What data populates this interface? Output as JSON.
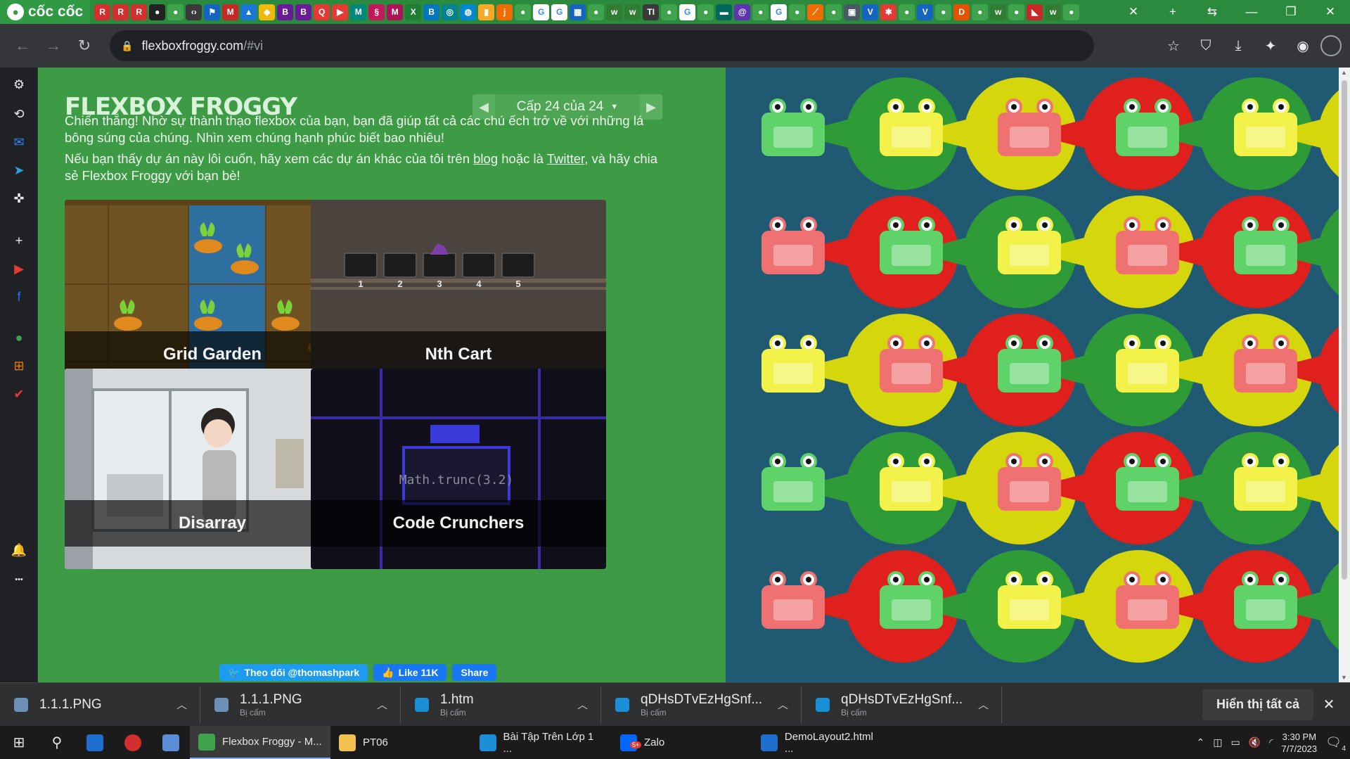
{
  "browser": {
    "brand_name": "cốc cốc",
    "tab_icons": [
      {
        "name": "tab-icon-r-1",
        "glyph": "R",
        "color": "#d32f2f"
      },
      {
        "name": "tab-icon-r-2",
        "glyph": "R",
        "color": "#d32f2f"
      },
      {
        "name": "tab-icon-r-3",
        "glyph": "R",
        "color": "#d32f2f"
      },
      {
        "name": "tab-icon-github",
        "glyph": "●",
        "color": "#222222"
      },
      {
        "name": "tab-icon-coccoc-1",
        "glyph": "●",
        "color": "#3fa34d"
      },
      {
        "name": "tab-icon-code",
        "glyph": "‹›",
        "color": "#3a3a3a"
      },
      {
        "name": "tab-icon-flag",
        "glyph": "⚑",
        "color": "#1565c0"
      },
      {
        "name": "tab-icon-gmail",
        "glyph": "M",
        "color": "#c62828"
      },
      {
        "name": "tab-icon-contacts",
        "glyph": "▲",
        "color": "#1976d2"
      },
      {
        "name": "tab-icon-binance",
        "glyph": "◆",
        "color": "#f0b90b"
      },
      {
        "name": "tab-icon-b-1",
        "glyph": "B",
        "color": "#6a1b9a"
      },
      {
        "name": "tab-icon-b-2",
        "glyph": "B",
        "color": "#6a1b9a"
      },
      {
        "name": "tab-icon-quiz",
        "glyph": "Q",
        "color": "#e53935"
      },
      {
        "name": "tab-icon-youtube",
        "glyph": "▶",
        "color": "#e53935"
      },
      {
        "name": "tab-icon-m",
        "glyph": "M",
        "color": "#00897b"
      },
      {
        "name": "tab-icon-swirl",
        "glyph": "§",
        "color": "#c2185b"
      },
      {
        "name": "tab-icon-m-2",
        "glyph": "M",
        "color": "#ad1457"
      },
      {
        "name": "tab-icon-excel",
        "glyph": "X",
        "color": "#1e7e34"
      },
      {
        "name": "tab-icon-b-3",
        "glyph": "B",
        "color": "#0277bd"
      },
      {
        "name": "tab-icon-wave",
        "glyph": "◎",
        "color": "#00838f"
      },
      {
        "name": "tab-icon-globe",
        "glyph": "◍",
        "color": "#0288d1"
      },
      {
        "name": "tab-icon-bars",
        "glyph": "▮",
        "color": "#f9a825"
      },
      {
        "name": "tab-icon-j",
        "glyph": "j",
        "color": "#ef6c00"
      },
      {
        "name": "tab-icon-coccoc-2",
        "glyph": "●",
        "color": "#3fa34d"
      },
      {
        "name": "tab-icon-google-1",
        "glyph": "G",
        "color": "#ffffff"
      },
      {
        "name": "tab-icon-google-2",
        "glyph": "G",
        "color": "#ffffff"
      },
      {
        "name": "tab-icon-grid",
        "glyph": "▦",
        "color": "#1565c0"
      },
      {
        "name": "tab-icon-coccoc-3",
        "glyph": "●",
        "color": "#3fa34d"
      },
      {
        "name": "tab-icon-w-1",
        "glyph": "w",
        "color": "#2e7d32"
      },
      {
        "name": "tab-icon-w-2",
        "glyph": "w",
        "color": "#2e7d32"
      },
      {
        "name": "tab-icon-ti",
        "glyph": "TI",
        "color": "#3a3a3a"
      },
      {
        "name": "tab-icon-coccoc-4",
        "glyph": "●",
        "color": "#3fa34d"
      },
      {
        "name": "tab-icon-google-3",
        "glyph": "G",
        "color": "#ffffff"
      },
      {
        "name": "tab-icon-coccoc-5",
        "glyph": "●",
        "color": "#3fa34d"
      },
      {
        "name": "tab-icon-dash",
        "glyph": "▬",
        "color": "#00695c"
      },
      {
        "name": "tab-icon-at",
        "glyph": "@",
        "color": "#5e35b1"
      },
      {
        "name": "tab-icon-coccoc-6",
        "glyph": "●",
        "color": "#3fa34d"
      },
      {
        "name": "tab-icon-google-4",
        "glyph": "G",
        "color": "#ffffff"
      },
      {
        "name": "tab-icon-coccoc-7",
        "glyph": "●",
        "color": "#3fa34d"
      },
      {
        "name": "tab-icon-slash",
        "glyph": "⟋",
        "color": "#ef6c00"
      },
      {
        "name": "tab-icon-coccoc-8",
        "glyph": "●",
        "color": "#3fa34d"
      },
      {
        "name": "tab-icon-box",
        "glyph": "▣",
        "color": "#455a64"
      },
      {
        "name": "tab-icon-v-1",
        "glyph": "V",
        "color": "#1565c0"
      },
      {
        "name": "tab-icon-star",
        "glyph": "✱",
        "color": "#e53935"
      },
      {
        "name": "tab-icon-coccoc-9",
        "glyph": "●",
        "color": "#3fa34d"
      },
      {
        "name": "tab-icon-v-2",
        "glyph": "V",
        "color": "#1565c0"
      },
      {
        "name": "tab-icon-coccoc-10",
        "glyph": "●",
        "color": "#3fa34d"
      },
      {
        "name": "tab-icon-d",
        "glyph": "D",
        "color": "#e65100"
      },
      {
        "name": "tab-icon-coccoc-11",
        "glyph": "●",
        "color": "#3fa34d"
      },
      {
        "name": "tab-icon-w-3",
        "glyph": "w",
        "color": "#2e7d32"
      },
      {
        "name": "tab-icon-coccoc-12",
        "glyph": "●",
        "color": "#3fa34d"
      },
      {
        "name": "tab-icon-hat",
        "glyph": "◣",
        "color": "#c62828"
      },
      {
        "name": "tab-icon-w-4",
        "glyph": "w",
        "color": "#2e7d32"
      },
      {
        "name": "tab-icon-coccoc-13",
        "glyph": "●",
        "color": "#3fa34d"
      }
    ],
    "url_host": "flexboxfroggy.com",
    "url_path": "/#vi"
  },
  "sidebar_icons": [
    {
      "name": "settings-icon",
      "glyph": "⚙",
      "color": "#e8eaed"
    },
    {
      "name": "history-icon",
      "glyph": "⟲",
      "color": "#e8eaed"
    },
    {
      "name": "messenger-icon",
      "glyph": "✉",
      "color": "#2d88ff"
    },
    {
      "name": "telegram-icon",
      "glyph": "➤",
      "color": "#2aa3e0"
    },
    {
      "name": "gamepad-icon",
      "glyph": "✜",
      "color": "#e8eaed"
    },
    {
      "name": "add-icon",
      "glyph": "+",
      "color": "#e8eaed"
    },
    {
      "name": "youtube-icon",
      "glyph": "▶",
      "color": "#e53935"
    },
    {
      "name": "facebook-icon",
      "glyph": "f",
      "color": "#1877f2"
    },
    {
      "name": "coccoc-green-icon",
      "glyph": "●",
      "color": "#3fa34d"
    },
    {
      "name": "shop-icon",
      "glyph": "⊞",
      "color": "#f57c00"
    },
    {
      "name": "todo-icon",
      "glyph": "✔",
      "color": "#e53935"
    },
    {
      "name": "bell-icon",
      "glyph": "🔔",
      "color": "#e8eaed"
    },
    {
      "name": "more-icon",
      "glyph": "•••",
      "color": "#e8eaed"
    }
  ],
  "game": {
    "title": "FLEXBOX FROGGY",
    "level_label": "Cấp 24 của 24",
    "win_text": "Chiến thắng! Nhờ sự thành thạo flexbox của bạn, bạn đã giúp tất cả các chú ếch trở về với những lá bông súng của chúng. Nhìn xem chúng hạnh phúc biết bao nhiêu!",
    "promo_before_blog": "Nếu bạn thấy dự án này lôi cuốn, hãy xem các dự án khác của tôi trên ",
    "blog_link": "blog",
    "promo_between": " hoặc là ",
    "twitter_link": "Twitter",
    "promo_after": ", và hãy chia sẻ Flexbox Froggy với bạn bè!",
    "projects": [
      {
        "name": "Grid Garden"
      },
      {
        "name": "Nth Cart"
      },
      {
        "name": "Disarray"
      },
      {
        "name": "Code Crunchers",
        "code_snippet": "Math.trunc(3.2)"
      }
    ],
    "cart_numbers": [
      "1",
      "2",
      "3",
      "4",
      "5"
    ],
    "share": {
      "follow_label": "Theo dõi @thomashpark",
      "like_label": "Like 11K",
      "share_label": "Share"
    },
    "board": {
      "rows": [
        [
          "green",
          "yellow",
          "red",
          "green",
          "yellow"
        ],
        [
          "red",
          "green",
          "yellow",
          "red",
          "green"
        ],
        [
          "yellow",
          "red",
          "green",
          "yellow",
          "red"
        ],
        [
          "green",
          "yellow",
          "red",
          "green",
          "yellow"
        ],
        [
          "red",
          "green",
          "yellow",
          "red",
          "green"
        ]
      ]
    },
    "colors": {
      "page_bg": "#3d9b45",
      "board_bg": "#1f5a72",
      "green_pad": "#2e9b37",
      "green_frog": "#5fd36a",
      "yellow_pad": "#d6d60c",
      "yellow_frog": "#f2f24a",
      "red_pad": "#e0201d",
      "red_frog": "#f07171"
    }
  },
  "downloads": {
    "items": [
      {
        "name": "1.1.1.PNG",
        "sub": ""
      },
      {
        "name": "1.1.1.PNG",
        "sub": "Bị cấm"
      },
      {
        "name": "1.htm",
        "sub": "Bị cấm"
      },
      {
        "name": "qDHsDTvEzHgSnf...",
        "sub": "Bị cấm"
      },
      {
        "name": "qDHsDTvEzHgSnf...",
        "sub": "Bị cấm"
      }
    ],
    "show_all": "Hiển thị tất cả"
  },
  "taskbar": {
    "apps": [
      {
        "label": "Flexbox Froggy - M...",
        "color": "#3fa34d"
      },
      {
        "label": "PT06",
        "color": "#f2c14e"
      },
      {
        "label": "Bài Tập Trên Lớp 1 ...",
        "color": "#1a8fd8"
      },
      {
        "label": "Zalo",
        "color": "#0068ff"
      },
      {
        "label": "DemoLayout2.html ...",
        "color": "#1f6fd1"
      }
    ],
    "zalo_badge": "5+",
    "time": "3:30 PM",
    "date": "7/7/2023",
    "notification_count": "4"
  }
}
